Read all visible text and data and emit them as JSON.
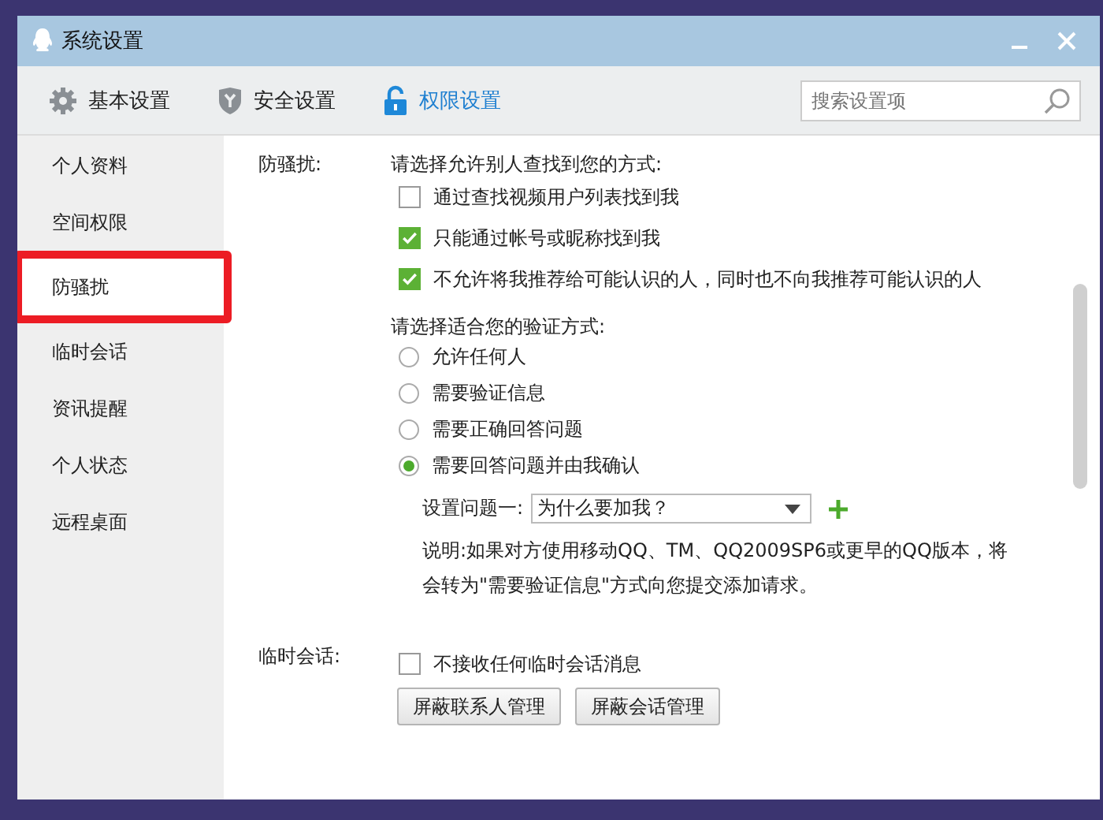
{
  "window": {
    "title": "系统设置"
  },
  "tabs": [
    {
      "label": "基本设置",
      "kind": "gear",
      "selected": false
    },
    {
      "label": "安全设置",
      "kind": "shield",
      "selected": false
    },
    {
      "label": "权限设置",
      "kind": "lock",
      "selected": true
    }
  ],
  "search": {
    "placeholder": "搜索设置项"
  },
  "sidebar": {
    "items": [
      {
        "label": "个人资料",
        "selected": false
      },
      {
        "label": "空间权限",
        "selected": false
      },
      {
        "label": "防骚扰",
        "selected": true
      },
      {
        "label": "临时会话",
        "selected": false
      },
      {
        "label": "资讯提醒",
        "selected": false
      },
      {
        "label": "个人状态",
        "selected": false
      },
      {
        "label": "远程桌面",
        "selected": false
      }
    ]
  },
  "anti_harassment": {
    "label": "防骚扰:",
    "find_prompt": "请选择允许别人查找到您的方式:",
    "find_options": [
      {
        "label": "通过查找视频用户列表找到我",
        "checked": false
      },
      {
        "label": "只能通过帐号或昵称找到我",
        "checked": true
      },
      {
        "label": "不允许将我推荐给可能认识的人，同时也不向我推荐可能认识的人",
        "checked": true
      }
    ],
    "verify_prompt": "请选择适合您的验证方式:",
    "verify_options": [
      {
        "label": "允许任何人",
        "selected": false
      },
      {
        "label": "需要验证信息",
        "selected": false
      },
      {
        "label": "需要正确回答问题",
        "selected": false
      },
      {
        "label": "需要回答问题并由我确认",
        "selected": true
      }
    ],
    "question_label": "设置问题一:",
    "question_value": "为什么要加我？",
    "note": "说明:如果对方使用移动QQ、TM、QQ2009SP6或更早的QQ版本，将会转为\"需要验证信息\"方式向您提交添加请求。"
  },
  "temp_session": {
    "label": "临时会话:",
    "option": {
      "label": "不接收任何临时会话消息",
      "checked": false
    },
    "buttons": [
      "屏蔽联系人管理",
      "屏蔽会话管理"
    ]
  }
}
